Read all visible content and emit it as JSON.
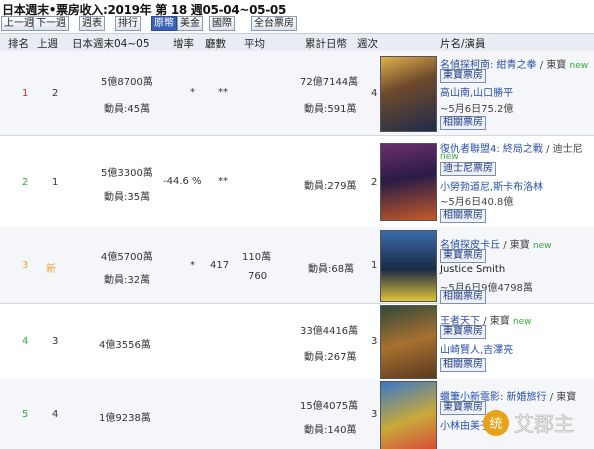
{
  "title": "日本週末•票房收入:2019年 第 18 週05-04~05-05",
  "toolbar": {
    "prev": "上一週",
    "next": "下一週",
    "week": "週表",
    "rank": "排行",
    "jp": "原幣",
    "us": "美金",
    "tw": "國際",
    "all": "全台票房"
  },
  "headers": [
    "排名",
    "上週",
    "日本週末04~05",
    "增率",
    "廳數",
    "平均",
    "累計日幣",
    "週次",
    "片名/演員"
  ],
  "rows": [
    {
      "rank": "1",
      "rank_color": "#c0392b",
      "last": "2",
      "weekend": "5億8700萬",
      "weekend2": "動員:45萬",
      "growth": "*",
      "screens": "**",
      "avg": "",
      "avg2": "",
      "total": "72億7144萬",
      "total2": "動員:591萬",
      "weeks": "4",
      "film1": "名偵探柯南: 紺青之拳",
      "film1b": "/ 東寶",
      "film1c": "new",
      "tag1": "東寶票房",
      "cast": "高山南,山口勝平",
      "date": "~5月6日75.2億",
      "tag2": "相關票房",
      "poster_colors": [
        "#6f4a2a",
        "#c9a85a",
        "#1e2b4a"
      ]
    },
    {
      "rank": "2",
      "rank_color": "#3aa640",
      "last": "1",
      "weekend": "5億3300萬",
      "weekend2": "動員:35萬",
      "growth": "-44.6 %",
      "screens": "**",
      "avg": "",
      "avg2": "",
      "total": "",
      "total2": "動員:279萬",
      "weeks": "2",
      "film1": "復仇者聯盟4: 終局之戰",
      "film1b": "/ 迪士尼",
      "film1c": "new",
      "tag1": "迪士尼票房",
      "cast": "小勞勃道尼,斯卡布洛林",
      "date": "~5月6日40.8億",
      "tag2": "相關票房",
      "poster_colors": [
        "#2a1b47",
        "#6b2f6f",
        "#c45a2a"
      ]
    },
    {
      "rank": "3",
      "rank_color": "#e8a23a",
      "last": "新",
      "weekend": "4億5700萬",
      "weekend2": "動員:32萬",
      "growth": "*",
      "screens": "417",
      "avg": "110萬",
      "avg2": "760",
      "total": "",
      "total2": "動員:68萬",
      "weeks": "1",
      "film1": "名偵探皮卡丘",
      "film1b": "/ 東寶",
      "film1c": "new",
      "tag1": "東寶票房",
      "cast": "Justice Smith",
      "date": "~5月6日9億4798萬",
      "tag2": "相關票房",
      "poster_colors": [
        "#1a2a44",
        "#3a6aa8",
        "#e0c23a"
      ]
    },
    {
      "rank": "4",
      "rank_color": "#3aa640",
      "last": "3",
      "weekend": "4億3556萬",
      "weekend2": "",
      "growth": "",
      "screens": "",
      "avg": "",
      "avg2": "",
      "total": "33億4416萬",
      "total2": "動員:267萬",
      "weeks": "3",
      "film1": "王者天下",
      "film1b": "/ 東寶",
      "film1c": "new",
      "tag1": "東寶票房",
      "cast": "山崎賢人,吉澤亮",
      "date": "",
      "tag2": "相關票房",
      "poster_colors": [
        "#5a3a1f",
        "#a8702f",
        "#2f4a3a"
      ]
    },
    {
      "rank": "5",
      "rank_color": "#3aa640",
      "last": "4",
      "weekend": "1億9238萬",
      "weekend2": "",
      "growth": "",
      "screens": "",
      "avg": "",
      "avg2": "",
      "total": "15億4075萬",
      "total2": "動員:140萬",
      "weeks": "3",
      "film1": "蠟筆小新電影: 新婚旅行",
      "film1b": "/ 東寶",
      "film1c": "new",
      "tag1": "東寶票房",
      "cast": "小林由美子",
      "date": "",
      "tag2": "",
      "poster_colors": [
        "#c8a93a",
        "#d84a3a",
        "#3a78c8"
      ]
    }
  ],
  "watermark": "统·艾郡主"
}
